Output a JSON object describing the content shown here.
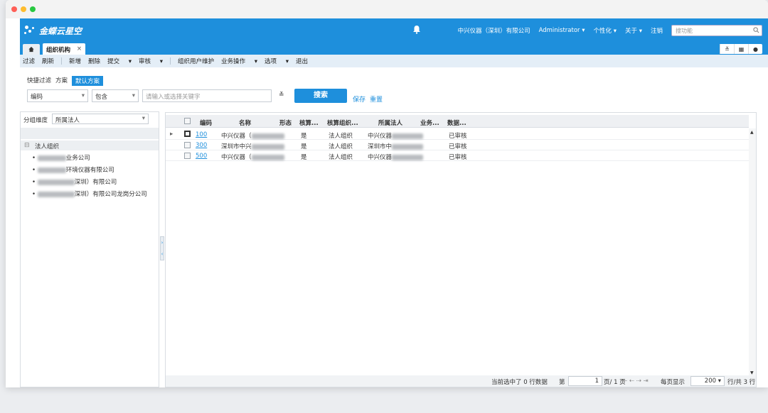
{
  "app": {
    "brand": "金蝶云星空",
    "company": "中兴仪器（深圳）有限公司",
    "user": "Administrator",
    "personalize": "个性化",
    "about": "关于",
    "logout": "注销",
    "search_placeholder": "搜功能"
  },
  "tabs": {
    "active": "组织机构",
    "close": "×"
  },
  "toolbar": {
    "items": [
      "过滤",
      "刷新",
      "新增",
      "删除",
      "提交",
      "审核",
      "组织用户维护",
      "业务操作",
      "选项",
      "退出"
    ]
  },
  "filter": {
    "quick_tabs": [
      "快捷过滤",
      "方案",
      "默认方案"
    ],
    "field": "编码",
    "op": "包含",
    "keyword_placeholder": "请输入或选择关键字",
    "search": "搜索",
    "save": "保存",
    "reset": "重置"
  },
  "left": {
    "group_label": "分组维度",
    "group_value": "所属法人",
    "root": "法人组织",
    "items": [
      "业务公司",
      "环境仪器有限公司",
      "深圳）有限公司",
      "深圳）有限公司龙岗分公司"
    ]
  },
  "grid": {
    "headers": [
      "编码",
      "名称",
      "形态",
      "核算...",
      "核算组织...",
      "所属法人",
      "业务...",
      "数据..."
    ],
    "rows": [
      {
        "code": "100",
        "name": "中兴仪器（",
        "form": "",
        "acct": "是",
        "acct_org": "法人组织",
        "legal": "中兴仪器",
        "status": "已审核"
      },
      {
        "code": "300",
        "name": "深圳市中兴",
        "form": "",
        "acct": "是",
        "acct_org": "法人组织",
        "legal": "深圳市中",
        "status": "已审核"
      },
      {
        "code": "500",
        "name": "中兴仪器（",
        "form": "",
        "acct": "是",
        "acct_org": "法人组织",
        "legal": "中兴仪器",
        "status": "已审核"
      }
    ]
  },
  "status": {
    "selected": "当前选中了 0 行数据",
    "page_label": "第",
    "page_value": "1",
    "page_total": "页/ 1 页",
    "per_page_label": "每页显示",
    "per_page_value": "200",
    "total": "行/共 3 行"
  }
}
